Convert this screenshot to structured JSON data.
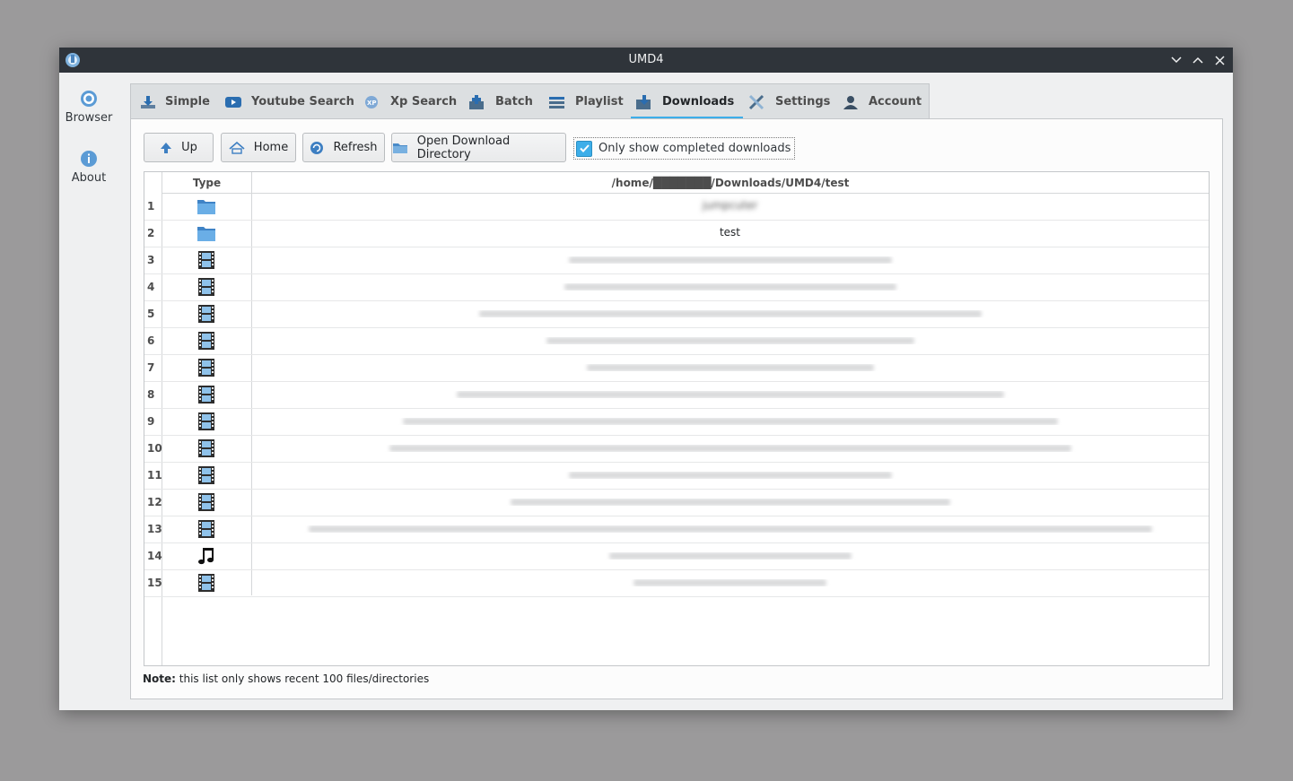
{
  "window": {
    "title": "UMD4"
  },
  "sidebar": {
    "items": [
      {
        "label": "Browser",
        "icon": "browser-icon"
      },
      {
        "label": "About",
        "icon": "info-icon"
      }
    ]
  },
  "tabs": [
    {
      "label": "Simple",
      "icon": "download-icon"
    },
    {
      "label": "Youtube Search",
      "icon": "youtube-icon"
    },
    {
      "label": "Xp Search",
      "icon": "xp-icon"
    },
    {
      "label": "Batch",
      "icon": "batch-icon"
    },
    {
      "label": "Playlist",
      "icon": "playlist-icon"
    },
    {
      "label": "Downloads",
      "icon": "downloads-icon",
      "active": true
    },
    {
      "label": "Settings",
      "icon": "settings-icon"
    },
    {
      "label": "Account",
      "icon": "account-icon"
    }
  ],
  "toolbar": {
    "up_label": "Up",
    "home_label": "Home",
    "refresh_label": "Refresh",
    "open_dir_label": "Open Download Directory",
    "only_completed_label": "Only show completed downloads",
    "only_completed_checked": true
  },
  "table": {
    "type_header": "Type",
    "path_header": "/home/███████/Downloads/UMD4/test",
    "rows": [
      {
        "num": "1",
        "type": "folder",
        "name": "jumpcuter"
      },
      {
        "num": "2",
        "type": "folder",
        "name": "test"
      },
      {
        "num": "3",
        "type": "video",
        "name": ""
      },
      {
        "num": "4",
        "type": "video",
        "name": ""
      },
      {
        "num": "5",
        "type": "video",
        "name": ""
      },
      {
        "num": "6",
        "type": "video",
        "name": ""
      },
      {
        "num": "7",
        "type": "video",
        "name": ""
      },
      {
        "num": "8",
        "type": "video",
        "name": ""
      },
      {
        "num": "9",
        "type": "video",
        "name": ""
      },
      {
        "num": "10",
        "type": "video",
        "name": ""
      },
      {
        "num": "11",
        "type": "video",
        "name": ""
      },
      {
        "num": "12",
        "type": "video",
        "name": ""
      },
      {
        "num": "13",
        "type": "video",
        "name": ""
      },
      {
        "num": "14",
        "type": "audio",
        "name": ""
      },
      {
        "num": "15",
        "type": "video",
        "name": ""
      }
    ]
  },
  "note": {
    "bold": "Note:",
    "text": " this list only shows recent 100 files/directories"
  },
  "colors": {
    "accent": "#3daee9",
    "titlebar": "#2f343a"
  }
}
